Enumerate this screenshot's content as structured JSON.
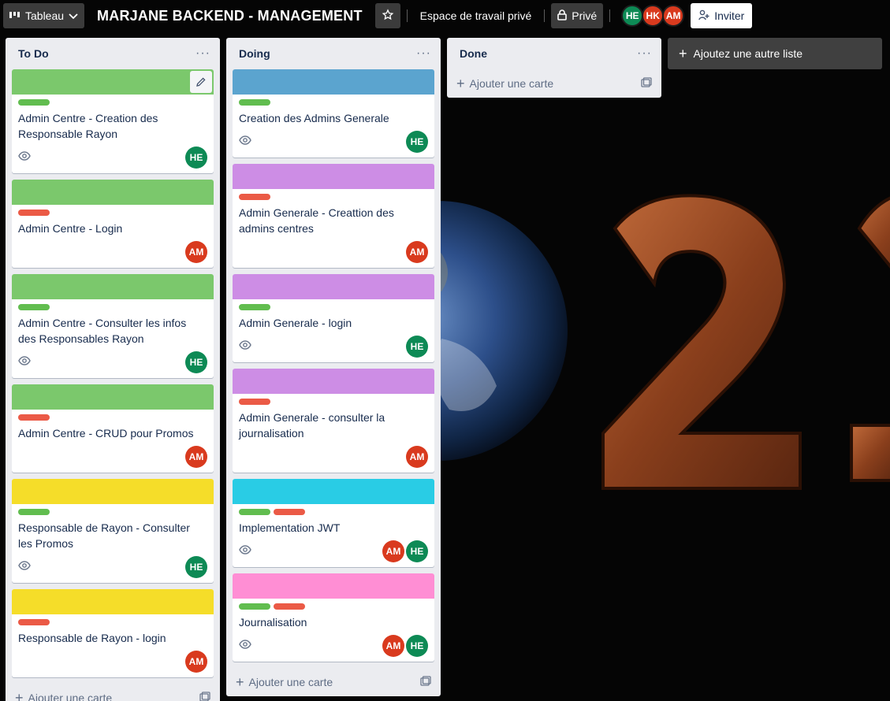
{
  "header": {
    "view_switcher_label": "Tableau",
    "board_title": "MARJANE BACKEND - MANAGEMENT",
    "workspace_label": "Espace de travail privé",
    "visibility_label": "Privé",
    "members": [
      "HE",
      "HK",
      "AM"
    ],
    "invite_label": "Inviter"
  },
  "lists": [
    {
      "title": "To Do",
      "menu": "···",
      "add_card_label": "Ajouter une carte",
      "cards": [
        {
          "cover": "#7bc86c",
          "labels": [
            "#61bd4f"
          ],
          "title": "Admin Centre - Creation des Responsable Rayon",
          "watch": true,
          "members": [
            "HE"
          ]
        },
        {
          "cover": "#7bc86c",
          "labels": [
            "#eb5a46"
          ],
          "title": "Admin Centre - Login",
          "watch": false,
          "members": [
            "AM"
          ]
        },
        {
          "cover": "#7bc86c",
          "labels": [
            "#61bd4f"
          ],
          "title": "Admin Centre - Consulter les infos des Responsables Rayon",
          "watch": true,
          "members": [
            "HE"
          ]
        },
        {
          "cover": "#7bc86c",
          "labels": [
            "#eb5a46"
          ],
          "title": "Admin Centre - CRUD pour Promos",
          "watch": false,
          "members": [
            "AM"
          ]
        },
        {
          "cover": "#f5dd29",
          "labels": [
            "#61bd4f"
          ],
          "title": "Responsable de Rayon - Consulter les Promos",
          "watch": true,
          "members": [
            "HE"
          ]
        },
        {
          "cover": "#f5dd29",
          "labels": [
            "#eb5a46"
          ],
          "title": "Responsable de Rayon - login",
          "watch": false,
          "members": [
            "AM"
          ]
        }
      ]
    },
    {
      "title": "Doing",
      "menu": "···",
      "add_card_label": "Ajouter une carte",
      "cards": [
        {
          "cover": "#5ba4cf",
          "labels": [
            "#61bd4f"
          ],
          "title": "Creation des Admins Generale",
          "watch": true,
          "members": [
            "HE"
          ]
        },
        {
          "cover": "#cd8de5",
          "labels": [
            "#eb5a46"
          ],
          "title": "Admin Generale - Creattion des admins centres",
          "watch": false,
          "members": [
            "AM"
          ]
        },
        {
          "cover": "#cd8de5",
          "labels": [
            "#61bd4f"
          ],
          "title": "Admin Generale - login",
          "watch": true,
          "members": [
            "HE"
          ]
        },
        {
          "cover": "#cd8de5",
          "labels": [
            "#eb5a46"
          ],
          "title": "Admin Generale - consulter la journalisation",
          "watch": false,
          "members": [
            "AM"
          ]
        },
        {
          "cover": "#29cce5",
          "labels": [
            "#61bd4f",
            "#eb5a46"
          ],
          "title": "Implementation JWT",
          "watch": true,
          "members": [
            "AM",
            "HE"
          ]
        },
        {
          "cover": "#ff8ed4",
          "labels": [
            "#61bd4f",
            "#eb5a46"
          ],
          "title": "Journalisation",
          "watch": true,
          "members": [
            "AM",
            "HE"
          ]
        }
      ]
    },
    {
      "title": "Done",
      "menu": "···",
      "add_card_label": "Ajouter une carte",
      "cards": []
    }
  ],
  "add_list_label": "Ajoutez une autre liste",
  "icons": {
    "view": "board-icon",
    "star": "star-icon",
    "lock": "lock-icon",
    "invite": "add-person-icon",
    "watch": "eye-icon",
    "template": "card-template-icon",
    "edit": "pencil-icon"
  },
  "colors": {
    "member_HE": "#0d8a55",
    "member_HK": "#d93a1e",
    "member_AM": "#d93a1e"
  }
}
